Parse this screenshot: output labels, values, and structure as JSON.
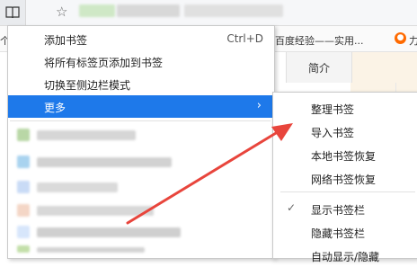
{
  "browser": {
    "bookmarks_bar": {
      "left_char": "个",
      "visible_item": "百度经验——实用...",
      "right_char": "力"
    },
    "page": {
      "column_header": "简介"
    }
  },
  "bookmark_menu": {
    "items": [
      {
        "label": "添加书签",
        "shortcut": "Ctrl+D"
      },
      {
        "label": "将所有标签页添加到书签",
        "shortcut": ""
      },
      {
        "label": "切换至侧边栏模式",
        "shortcut": ""
      },
      {
        "label": "更多",
        "shortcut": "",
        "has_submenu": true,
        "highlighted": true
      }
    ],
    "arrow_glyph": "›"
  },
  "more_submenu": {
    "items": [
      {
        "label": "整理书签",
        "checked": false
      },
      {
        "label": "导入书签",
        "checked": false
      },
      {
        "label": "本地书签恢复",
        "checked": false
      },
      {
        "label": "网络书签恢复",
        "checked": false
      },
      {
        "label": "显示书签栏",
        "checked": true
      },
      {
        "label": "隐藏书签栏",
        "checked": false
      },
      {
        "label": "自动显示/隐藏",
        "checked": false
      }
    ],
    "check_glyph": "✓"
  },
  "icons": {
    "bookmarks_button": "book-icon",
    "favorite": "star-icon",
    "baidu": "baidu-paw-icon",
    "annotation": "red-arrow"
  },
  "colors": {
    "highlight": "#1e79ea",
    "annotation_arrow": "#e8453c",
    "baidu": "#ff6a00"
  }
}
